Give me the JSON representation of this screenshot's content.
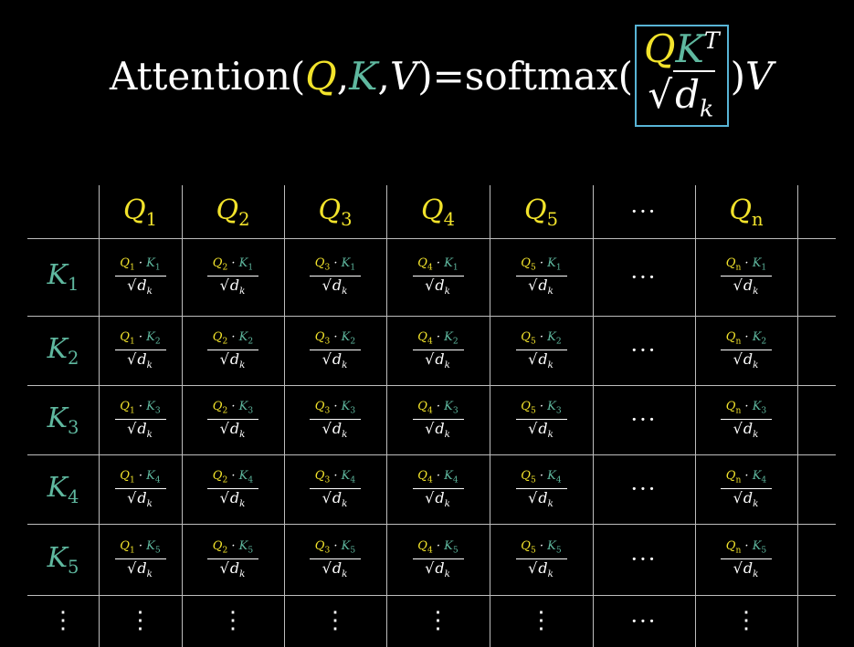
{
  "formula": {
    "lhs_name": "Attention",
    "open": "(",
    "q": "Q",
    "comma1": ",",
    "k": "K",
    "comma2": ",",
    "v": "V",
    "close": ")",
    "equals": "=",
    "fn": "softmax",
    "fn_open": "(",
    "num_q": "Q",
    "num_k": "K",
    "num_sup": "T",
    "den_sqrt": "√",
    "den_d": "d",
    "den_sub": "k",
    "fn_close": ")",
    "tail_v": "V"
  },
  "table": {
    "columns": [
      {
        "letter": "Q",
        "sub": "1"
      },
      {
        "letter": "Q",
        "sub": "2"
      },
      {
        "letter": "Q",
        "sub": "3"
      },
      {
        "letter": "Q",
        "sub": "4"
      },
      {
        "letter": "Q",
        "sub": "5"
      },
      {
        "ellipsis": "···"
      },
      {
        "letter": "Q",
        "sub": "n"
      }
    ],
    "rows": [
      {
        "letter": "K",
        "sub": "1"
      },
      {
        "letter": "K",
        "sub": "2"
      },
      {
        "letter": "K",
        "sub": "3"
      },
      {
        "letter": "K",
        "sub": "4"
      },
      {
        "letter": "K",
        "sub": "5"
      }
    ],
    "dot": "·",
    "denominator": {
      "sqrt": "√",
      "d": "d",
      "sub": "k"
    },
    "row_ellipsis": "⋮",
    "col_ellipsis": "···"
  },
  "colors": {
    "query": "#f2e32b",
    "key": "#5fb89f",
    "highlight_box": "#58b4d6",
    "grid": "#bdbdbd"
  }
}
